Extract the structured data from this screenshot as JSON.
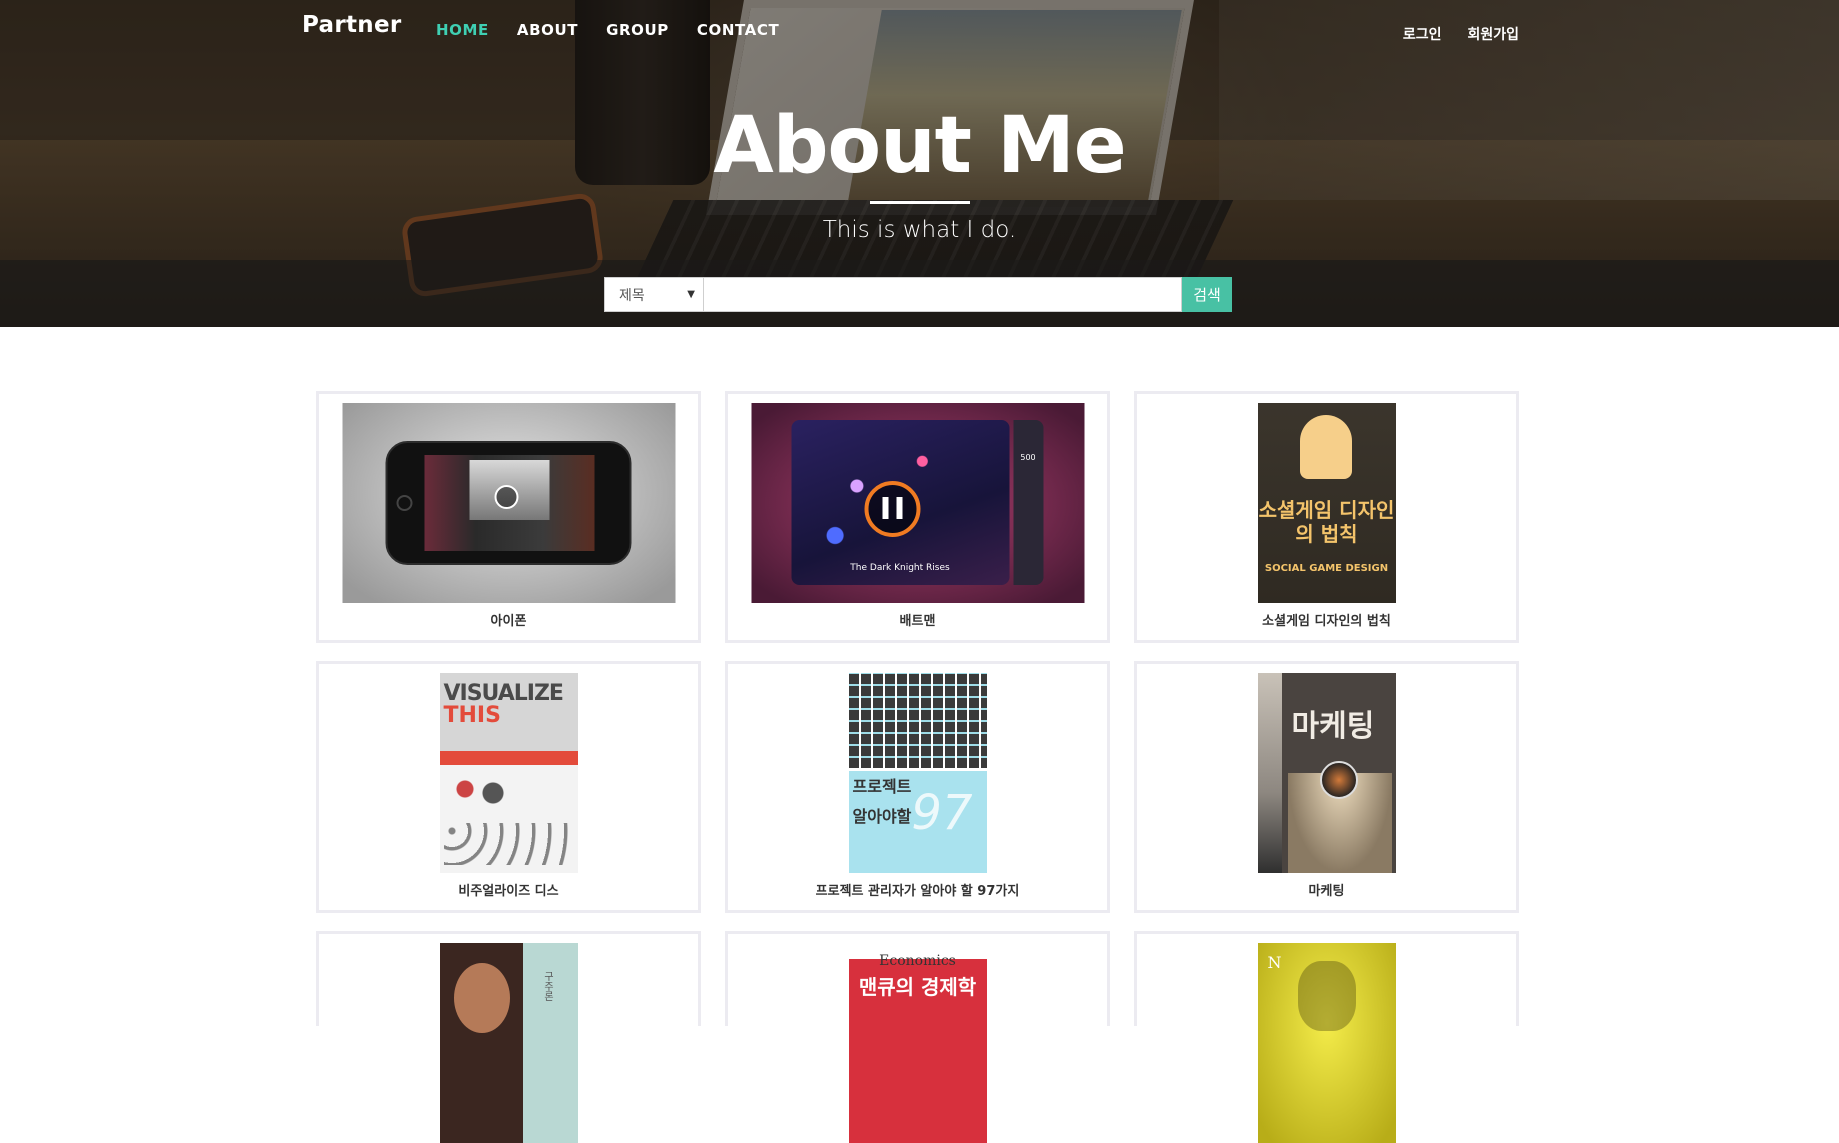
{
  "header": {
    "brand": "Partner",
    "nav": [
      {
        "label": "HOME",
        "active": true
      },
      {
        "label": "ABOUT",
        "active": false
      },
      {
        "label": "GROUP",
        "active": false
      },
      {
        "label": "CONTACT",
        "active": false
      }
    ],
    "auth": {
      "login": "로그인",
      "signup": "회원가입"
    }
  },
  "hero": {
    "title": "About Me",
    "subtitle": "This is what I do."
  },
  "search": {
    "category": "제목",
    "input_value": "",
    "button_label": "검색"
  },
  "colors": {
    "accent": "#3fcfb3",
    "search_button": "#48c1a4",
    "card_border": "#ecebf1"
  },
  "items": [
    {
      "label": "아이폰",
      "thumb": "iphone-player"
    },
    {
      "label": "배트맨",
      "thumb": "batman-player",
      "caption": "The Dark Knight Rises",
      "count": "500"
    },
    {
      "label": "소셜게임 디자인의 법칙",
      "thumb": "book-cover",
      "cover_title": "소셜게임 디자인의 법칙",
      "cover_sub": "SOCIAL GAME DESIGN"
    },
    {
      "label": "비주얼라이즈 디스",
      "thumb": "book-cover",
      "cover_title_1": "VISUALIZE",
      "cover_title_2": "THIS"
    },
    {
      "label": "프로젝트 관리자가 알아야 할 97가지",
      "thumb": "book-cover",
      "cover_title_1": "프로젝트",
      "cover_title_2": "알아야할",
      "cover_number": "97"
    },
    {
      "label": "마케팅",
      "thumb": "book-cover",
      "cover_title": "마케팅"
    },
    {
      "label": "",
      "thumb": "book-cover",
      "cover_title": "구주론"
    },
    {
      "label": "",
      "thumb": "book-cover",
      "cover_title_1": "Economics",
      "cover_title_2": "맨큐의 경제학"
    },
    {
      "label": "",
      "thumb": "book-cover",
      "cover_title": "N"
    }
  ]
}
